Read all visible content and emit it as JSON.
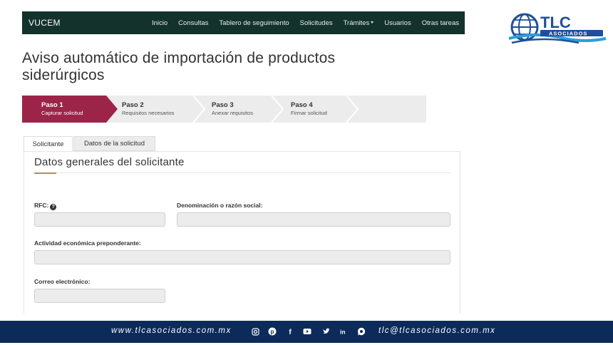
{
  "navbar": {
    "brand": "VUCEM",
    "links": [
      "Inicio",
      "Consultas",
      "Tablero de seguimiento",
      "Solicitudes",
      "Trámites",
      "Usuarios",
      "Otras tareas"
    ]
  },
  "logo": {
    "name": "TLC",
    "subtitle": "ASOCIADOS"
  },
  "page": {
    "title": "Aviso automático de importación de productos siderúrgicos"
  },
  "stepper": {
    "active_color": "#9d2449",
    "steps": [
      {
        "title": "Paso 1",
        "subtitle": "Capturar solicitud"
      },
      {
        "title": "Paso 2",
        "subtitle": "Requisitos necesarios"
      },
      {
        "title": "Paso 3",
        "subtitle": "Anexar requisitos"
      },
      {
        "title": "Paso 4",
        "subtitle": "Firmar solicitud"
      }
    ]
  },
  "tabs": [
    {
      "label": "Solicitante",
      "active": true
    },
    {
      "label": "Datos de la solicitud",
      "active": false
    }
  ],
  "section": {
    "title": "Datos generales del solicitante"
  },
  "form": {
    "rfc_label": "RFC:",
    "rfc_value": "",
    "razon_label": "Denominación o razón social:",
    "razon_value": "",
    "actividad_label": "Actividad económica preponderante:",
    "actividad_value": "",
    "correo_label": "Correo electrónico:",
    "correo_value": ""
  },
  "footer": {
    "website": "www.tlcasociados.com.mx",
    "email": "tlc@tlcasociados.com.mx",
    "social_icons": [
      "instagram-icon",
      "pinterest-icon",
      "facebook-icon",
      "youtube-icon",
      "twitter-icon",
      "linkedin-icon",
      "whatsapp-icon"
    ],
    "background": "#0c2b5b"
  }
}
